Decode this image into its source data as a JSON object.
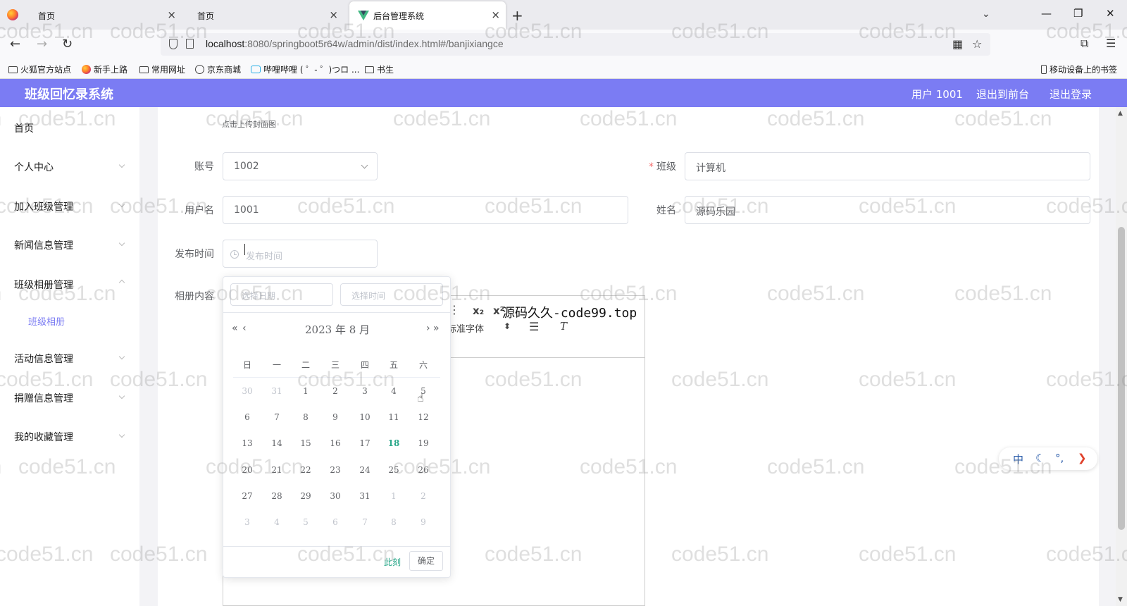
{
  "browser": {
    "tabs": [
      {
        "title": "首页"
      },
      {
        "title": "首页"
      },
      {
        "title": "后台管理系统"
      }
    ],
    "url": {
      "host": "localhost",
      "rest": ":8080/springboot5r64w/admin/dist/index.html#/banjixiangce"
    },
    "bookmarks": [
      "火狐官方站点",
      "新手上路",
      "常用网址",
      "京东商城",
      "哔哩哔哩 ( ゜- ゜)つロ ...",
      "书生",
      "移动设备上的书签"
    ]
  },
  "header": {
    "title": "班级回忆录系统",
    "user": "用户 1001",
    "to_front": "退出到前台",
    "logout": "退出登录"
  },
  "sidebar": {
    "items": [
      "首页",
      "个人中心",
      "加入班级管理",
      "新闻信息管理",
      "班级相册管理",
      "活动信息管理",
      "捐赠信息管理",
      "我的收藏管理"
    ],
    "sub_item": "班级相册"
  },
  "form": {
    "upload_hint": "点击上传封面图",
    "account_label": "账号",
    "account_value": "1002",
    "class_label": "班级",
    "class_value": "计算机",
    "username_label": "用户名",
    "username_value": "1001",
    "name_label": "姓名",
    "name_value": "源码乐园",
    "publish_label": "发布时间",
    "publish_placeholder": "发布时间",
    "content_label": "相册内容"
  },
  "editor": {
    "sub": "x₂",
    "sup": "x²",
    "font": "标准字体",
    "overlay_text": "源码久久-code99.top"
  },
  "datepicker": {
    "date_placeholder": "选择日期",
    "time_placeholder": "选择时间",
    "title": "2023 年  8 月",
    "weekdays": [
      "日",
      "一",
      "二",
      "三",
      "四",
      "五",
      "六"
    ],
    "days": [
      [
        "30",
        "31",
        "1",
        "2",
        "3",
        "4",
        "5"
      ],
      [
        "6",
        "7",
        "8",
        "9",
        "10",
        "11",
        "12"
      ],
      [
        "13",
        "14",
        "15",
        "16",
        "17",
        "18",
        "19"
      ],
      [
        "20",
        "21",
        "22",
        "23",
        "24",
        "25",
        "26"
      ],
      [
        "27",
        "28",
        "29",
        "30",
        "31",
        "1",
        "2"
      ],
      [
        "3",
        "4",
        "5",
        "6",
        "7",
        "8",
        "9"
      ]
    ],
    "today": "18",
    "now_label": "此刻",
    "confirm_label": "确定"
  },
  "ime": {
    "chinese": "中"
  },
  "watermark": "code51.cn",
  "colors": {
    "accent": "#7b7cf3",
    "today": "#2aa88a",
    "required": "#f56c6c"
  }
}
